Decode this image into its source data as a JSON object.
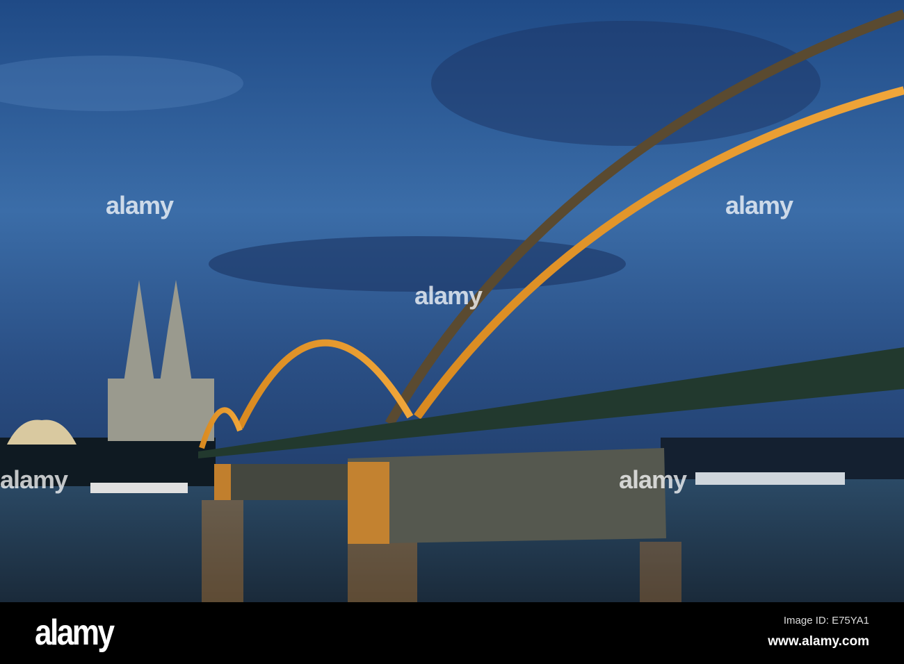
{
  "watermark": {
    "text": "alamy"
  },
  "footer": {
    "logo": "alamy",
    "image_id": "Image ID: E75YA1",
    "website": "www.alamy.com"
  }
}
